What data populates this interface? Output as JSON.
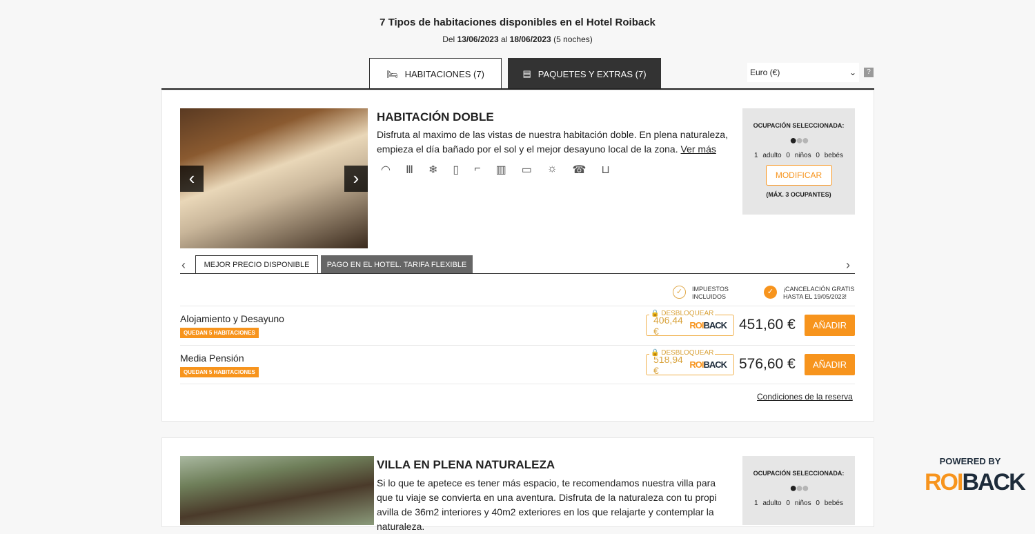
{
  "header": {
    "title": "7 Tipos de habitaciones disponibles en el Hotel Roiback",
    "dates_prefix": "Del",
    "date_from": "13/06/2023",
    "dates_mid": "al",
    "date_to": "18/06/2023",
    "nights": "(5 noches)"
  },
  "tabs": [
    {
      "label": "HABITACIONES (7)",
      "icon": "bed-icon"
    },
    {
      "label": "PAQUETES Y EXTRAS (7)",
      "icon": "package-icon"
    }
  ],
  "currency": {
    "selected": "Euro (€)",
    "help": "?"
  },
  "rooms": [
    {
      "name": "HABITACIÓN DOBLE",
      "description": "Disfruta al maximo de las vistas de nuestra habitación doble. En plena naturaleza, empieza el día bañado por el sol y el mejor desayuno local de la zona.",
      "more": "Ver más",
      "amenities": [
        "wifi-icon",
        "heating-icon",
        "air-conditioning-icon",
        "toiletries-icon",
        "hairdryer-icon",
        "minibar-icon",
        "tv-icon",
        "terrace-icon",
        "phone-icon",
        "xxl-bed-icon"
      ],
      "occupancy": {
        "title": "OCUPACIÓN SELECCIONADA:",
        "counts": "1 adulto  0 niños  0 bebés",
        "modify": "MODIFICAR",
        "max": "(MÁX. 3 OCUPANTES)"
      },
      "rate_tabs": [
        "MEJOR PRECIO DISPONIBLE",
        "PAGO EN EL HOTEL. TARIFA FLEXIBLE"
      ],
      "perks": [
        "IMPUESTOS INCLUIDOS",
        "¡CANCELACIÓN GRATIS HASTA EL 19/05/2023!"
      ],
      "rates": [
        {
          "board": "Alojamiento y Desayuno",
          "badge": "QUEDAN 5 HABITACIONES",
          "unlock_label": "DESBLOQUEAR",
          "member_price": "406,44 €",
          "price": "451,60 €",
          "add": "AÑADIR"
        },
        {
          "board": "Media Pensión",
          "badge": "QUEDAN 5 HABITACIONES",
          "unlock_label": "DESBLOQUEAR",
          "member_price": "518,94 €",
          "price": "576,60 €",
          "add": "AÑADIR"
        }
      ],
      "conditions": "Condiciones de la reserva"
    },
    {
      "name": "VILLA EN PLENA NATURALEZA",
      "description": "Si lo que te apetece es tener más espacio, te recomendamos nuestra villa para que tu viaje se convierta en una aventura. Disfruta de la naturaleza con tu propi avilla de 36m2 interiores y 40m2 exteriores en los que relajarte y contemplar la naturaleza.",
      "occupancy": {
        "title": "OCUPACIÓN SELECCIONADA:",
        "counts": "1 adulto  0 niños  0 bebés"
      }
    }
  ],
  "brand": {
    "powered": "POWERED BY",
    "logo_a": "ROI",
    "logo_b": "BACK"
  },
  "colors": {
    "accent": "#f7941d",
    "dark": "#333333"
  }
}
